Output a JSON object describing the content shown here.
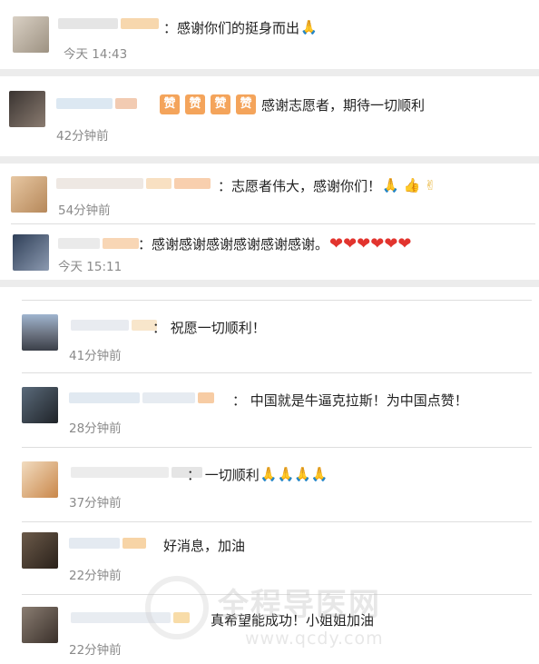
{
  "comments": [
    {
      "text": "：感谢你们的挺身而出",
      "emoji": "🙏",
      "time": "今天 14:43"
    },
    {
      "badges": [
        "赞",
        "赞",
        "赞",
        "赞"
      ],
      "text": "感谢志愿者，期待一切顺利",
      "time": "42分钟前"
    },
    {
      "text": "：志愿者伟大，感谢你们！",
      "emoji": "🙏 👍 ✌",
      "time": "54分钟前"
    },
    {
      "text": "：感谢感谢感谢感谢感谢感谢。",
      "emoji": "❤❤❤❤❤❤",
      "time": "今天 15:11"
    },
    {
      "text": "：  祝愿一切顺利！",
      "time": "41分钟前"
    },
    {
      "text": "：  中国就是牛逼克拉斯！为中国点赞！",
      "time": "28分钟前"
    },
    {
      "text": "：  一切顺利",
      "emoji": "🙏🙏🙏🙏",
      "time": "37分钟前"
    },
    {
      "text": "好消息，加油",
      "time": "22分钟前"
    },
    {
      "text": "真希望能成功！小姐姐加油",
      "time": "22分钟前"
    }
  ],
  "watermark": {
    "brand": "全程导医网",
    "url": "www.qcdy.com"
  },
  "colors": {
    "background": "#ececec",
    "card": "#ffffff",
    "time": "#8a8a8a",
    "text": "#222222"
  }
}
